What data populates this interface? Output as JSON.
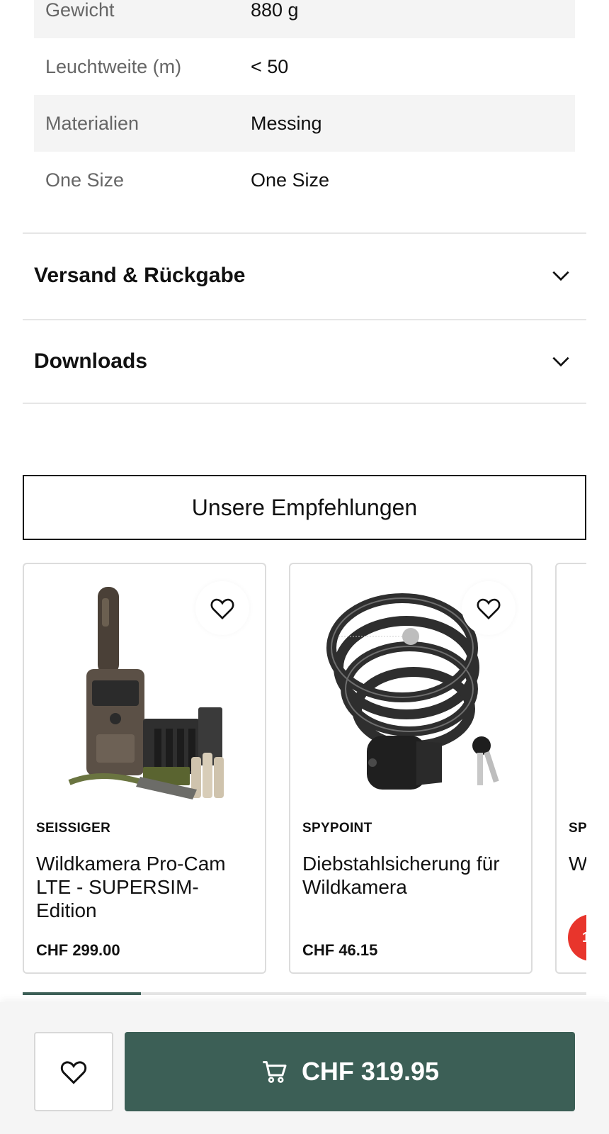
{
  "specs": [
    {
      "key": "Gewicht",
      "value": "880 g"
    },
    {
      "key": "Leuchtweite (m)",
      "value": "< 50"
    },
    {
      "key": "Materialien",
      "value": "Messing"
    },
    {
      "key": "One Size",
      "value": "One Size"
    }
  ],
  "accordions": [
    {
      "title": "Versand & Rückgabe",
      "icon": "chevron-down-icon"
    },
    {
      "title": "Downloads",
      "icon": "chevron-down-icon"
    }
  ],
  "recommendations": {
    "title": "Unsere Empfehlungen",
    "products": [
      {
        "brand": "SEISSIGER",
        "name": "Wildkamera Pro-Cam LTE - SUPERSIM-Edition",
        "price": "CHF 299.00"
      },
      {
        "brand": "SPYPOINT",
        "name": "Diebstahlsicherung für Wildkamera",
        "price": "CHF 46.15"
      },
      {
        "brand": "SP",
        "name": "W",
        "badge": "1"
      }
    ],
    "scroll_progress": 0.21
  },
  "sticky_bar": {
    "price": "CHF 319.95",
    "cart_icon": "cart-icon",
    "wishlist_icon": "heart-icon"
  },
  "colors": {
    "accent": "#3c5f56",
    "badge": "#e8352c"
  }
}
